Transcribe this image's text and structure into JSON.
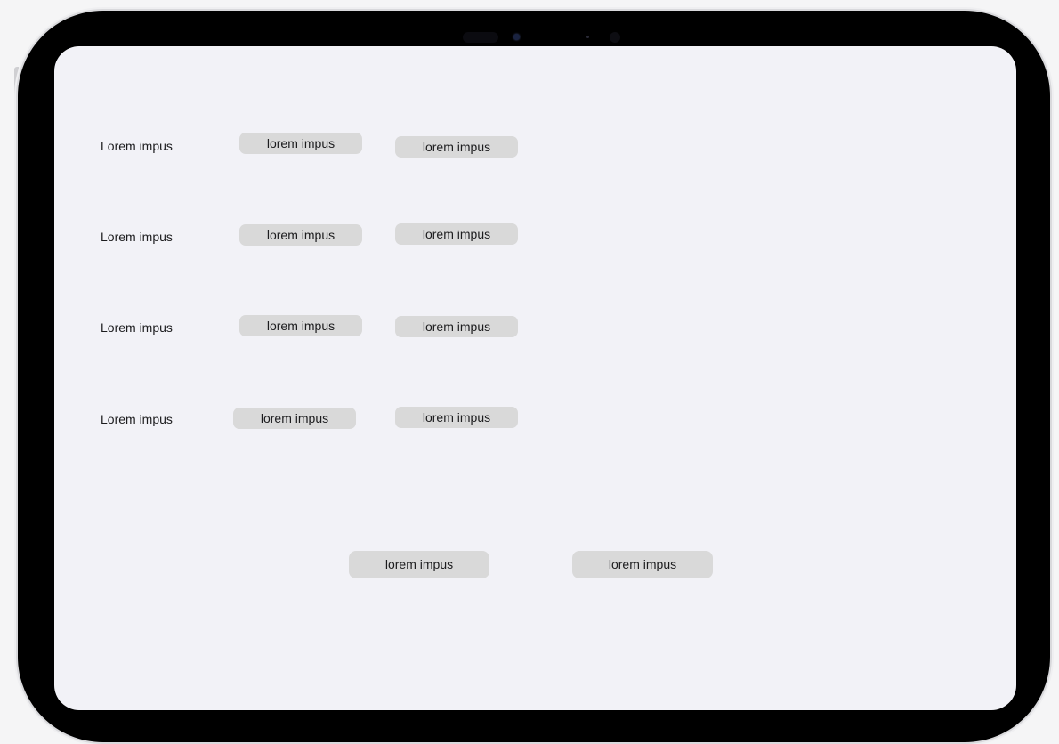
{
  "rows": [
    {
      "label": "Lorem impus",
      "option_a": "lorem impus",
      "option_b": "lorem impus"
    },
    {
      "label": "Lorem impus",
      "option_a": "lorem impus",
      "option_b": "lorem impus"
    },
    {
      "label": "Lorem impus",
      "option_a": "lorem impus",
      "option_b": "lorem impus"
    },
    {
      "label": "Lorem impus",
      "option_a": "lorem impus",
      "option_b": "lorem impus"
    }
  ],
  "actions": {
    "primary_label": "lorem impus",
    "secondary_label": "lorem impus"
  },
  "colors": {
    "screen_background": "#f2f2f7",
    "button_fill": "#d9d9d9",
    "device_bezel": "#000000",
    "text": "#1c1c1e"
  }
}
